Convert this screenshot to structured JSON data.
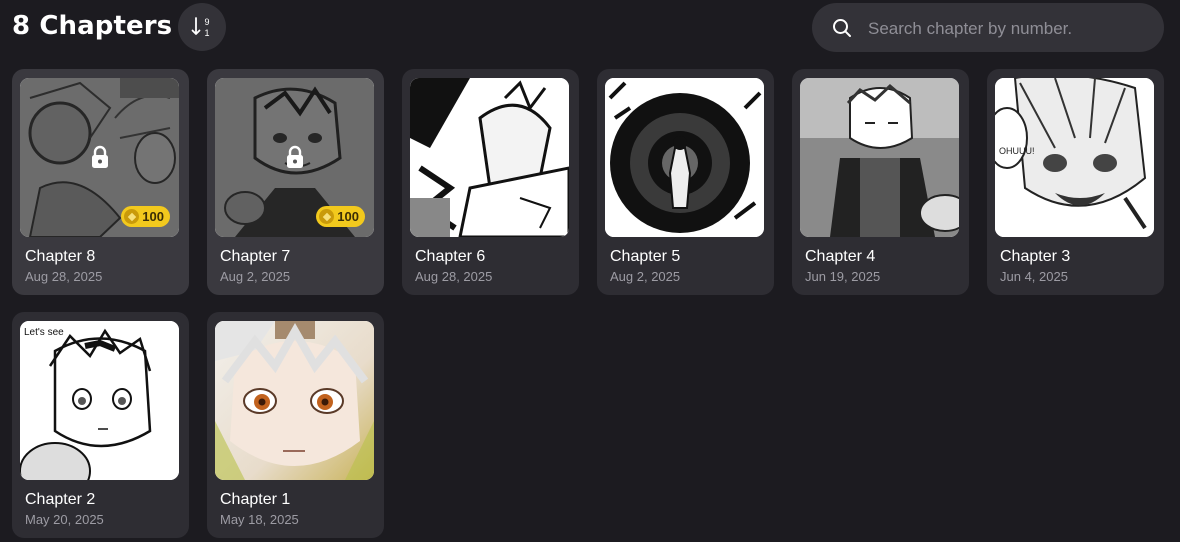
{
  "header": {
    "title": "8 Chapters",
    "sort_icon": "sort-descending-9-1-icon",
    "search": {
      "placeholder": "Search chapter by number.",
      "value": "",
      "icon": "search-icon"
    }
  },
  "chapters": [
    {
      "title": "Chapter 8",
      "date": "Aug 28, 2025",
      "locked": true,
      "price": "100"
    },
    {
      "title": "Chapter 7",
      "date": "Aug 2, 2025",
      "locked": true,
      "price": "100"
    },
    {
      "title": "Chapter 6",
      "date": "Aug 28, 2025",
      "locked": false
    },
    {
      "title": "Chapter 5",
      "date": "Aug 2, 2025",
      "locked": false
    },
    {
      "title": "Chapter 4",
      "date": "Jun 19, 2025",
      "locked": false
    },
    {
      "title": "Chapter 3",
      "date": "Jun 4, 2025",
      "locked": false
    },
    {
      "title": "Chapter 2",
      "date": "May 20, 2025",
      "locked": false
    },
    {
      "title": "Chapter 1",
      "date": "May 18, 2025",
      "locked": false
    }
  ],
  "colors": {
    "background": "#1c1b20",
    "card": "#2e2d33",
    "coin": "#f2c91d"
  }
}
